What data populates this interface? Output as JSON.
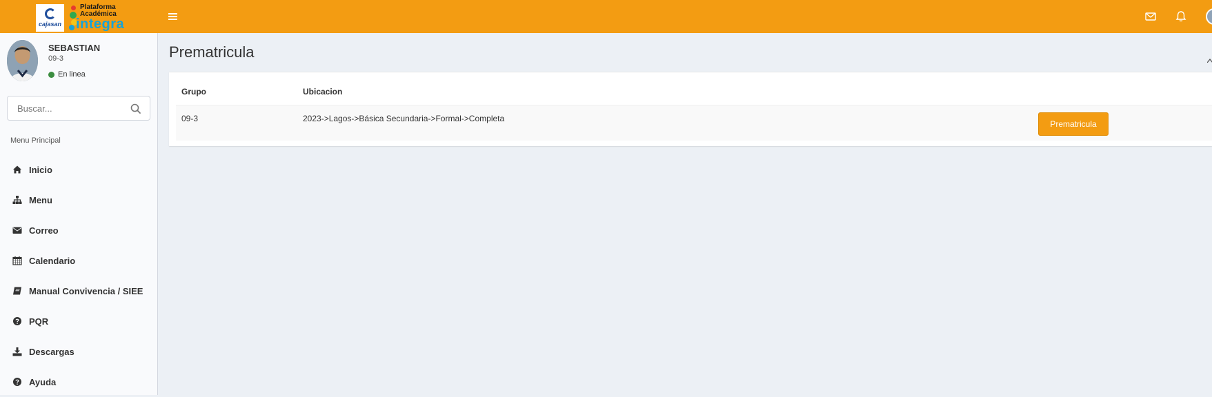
{
  "header": {
    "logo_text": "cajasan",
    "brand_line1": "Plataforma",
    "brand_line2": "Académica",
    "brand_name": "integra"
  },
  "user": {
    "name": "SEBASTIAN",
    "group": "09-3",
    "status": "En linea"
  },
  "search": {
    "placeholder": "Buscar..."
  },
  "sidebar": {
    "menu_header": "Menu Principal",
    "items": [
      {
        "label": "Inicio",
        "icon": "home-icon"
      },
      {
        "label": "Menu",
        "icon": "sitemap-icon"
      },
      {
        "label": "Correo",
        "icon": "envelope-icon"
      },
      {
        "label": "Calendario",
        "icon": "calendar-icon"
      },
      {
        "label": "Manual Convivencia / SIEE",
        "icon": "book-icon"
      },
      {
        "label": "PQR",
        "icon": "question-circle-icon"
      },
      {
        "label": "Descargas",
        "icon": "download-icon"
      },
      {
        "label": "Ayuda",
        "icon": "question-circle-icon"
      }
    ]
  },
  "content": {
    "title": "Prematricula",
    "table": {
      "headers": [
        "Grupo",
        "Ubicacion"
      ],
      "rows": [
        {
          "grupo": "09-3",
          "ubicacion": "2023->Lagos->Básica Secundaria->Formal->Completa",
          "action": "Prematricula"
        }
      ]
    }
  },
  "colors": {
    "header_bg": "#f39c12",
    "sidebar_bg": "#f9fafc",
    "content_bg": "#ecf0f5",
    "status_online": "#3c8d40"
  }
}
